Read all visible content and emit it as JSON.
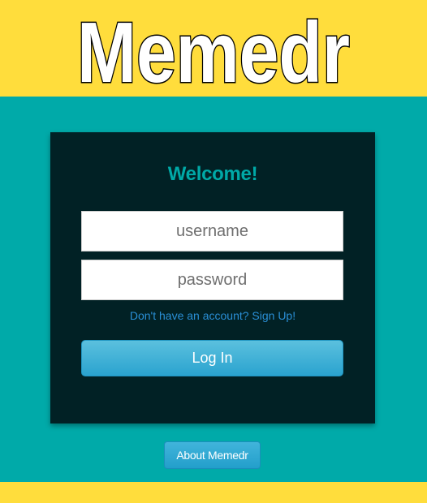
{
  "header": {
    "logo_text": "Memedr"
  },
  "login_card": {
    "title": "Welcome!",
    "username": {
      "value": "",
      "placeholder": "username"
    },
    "password": {
      "value": "",
      "placeholder": "password"
    },
    "signup_link": "Don't have an account? Sign Up!",
    "login_button": "Log In"
  },
  "footer": {
    "about_button": "About Memedr"
  },
  "colors": {
    "yellow_band": "#FFDD3C",
    "teal_background": "#00AAA9",
    "card_background": "#012125",
    "welcome_text": "#00A9A7",
    "link_blue": "#2A8FD6",
    "button_blue": "#2AA3CF"
  }
}
